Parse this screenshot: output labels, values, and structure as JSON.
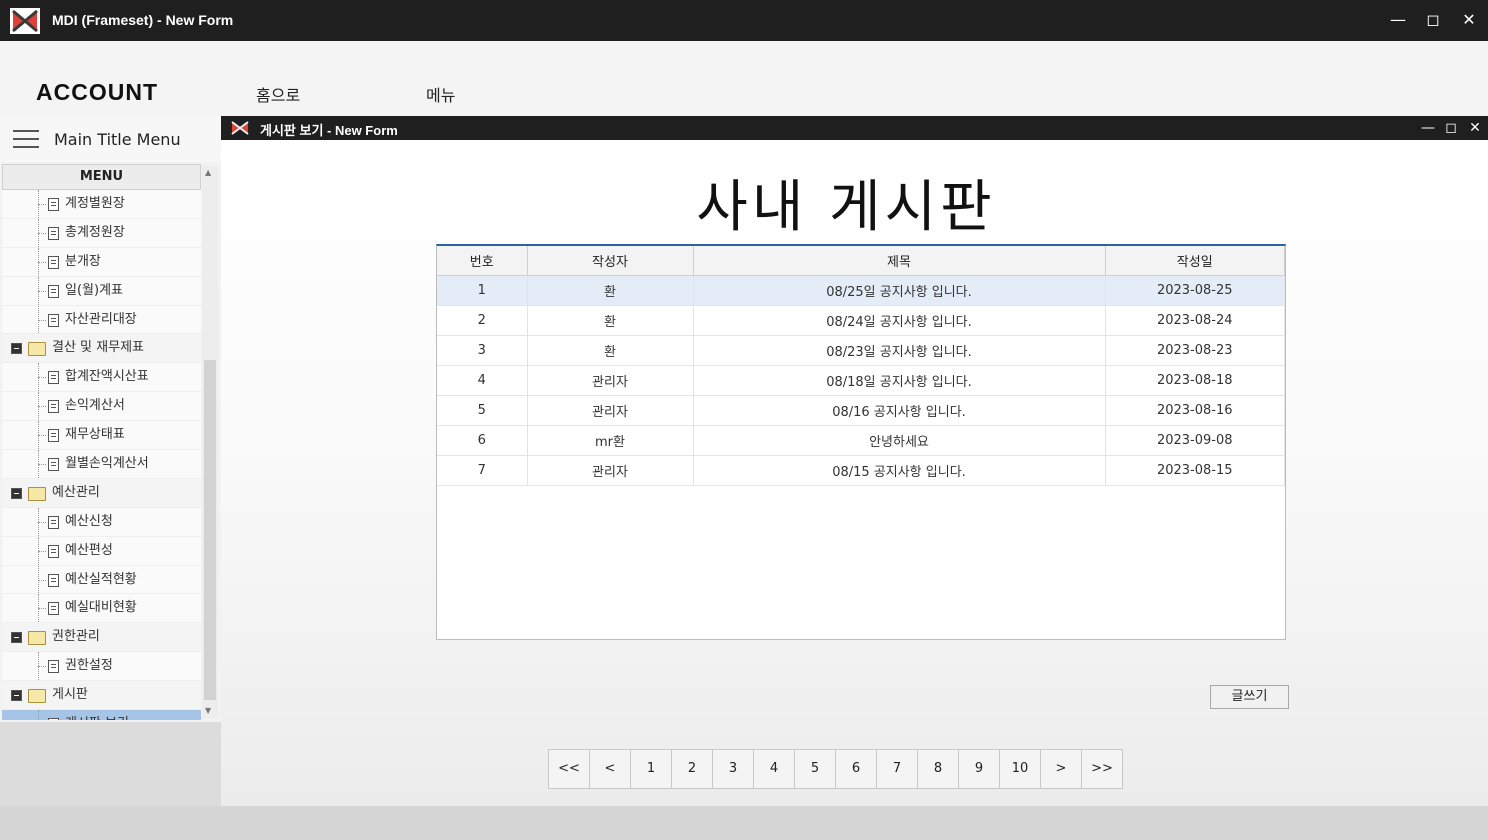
{
  "window": {
    "title": "MDI (Frameset) - New Form"
  },
  "topnav": {
    "brand": "ACCOUNT",
    "links": [
      "홈으로",
      "메뉴"
    ]
  },
  "sidebar": {
    "title": "Main Title Menu",
    "menu_header": "MENU",
    "items": [
      {
        "label": "계정별원장",
        "type": "leaf"
      },
      {
        "label": "총계정원장",
        "type": "leaf"
      },
      {
        "label": "분개장",
        "type": "leaf"
      },
      {
        "label": "일(월)계표",
        "type": "leaf"
      },
      {
        "label": "자산관리대장",
        "type": "leaf"
      },
      {
        "label": "결산 및 재무제표",
        "type": "folder"
      },
      {
        "label": "합계잔액시산표",
        "type": "leaf"
      },
      {
        "label": "손익계산서",
        "type": "leaf"
      },
      {
        "label": "재무상태표",
        "type": "leaf"
      },
      {
        "label": "월별손익계산서",
        "type": "leaf"
      },
      {
        "label": "예산관리",
        "type": "folder"
      },
      {
        "label": "예산신청",
        "type": "leaf"
      },
      {
        "label": "예산편성",
        "type": "leaf"
      },
      {
        "label": "예산실적현황",
        "type": "leaf"
      },
      {
        "label": "예실대비현황",
        "type": "leaf"
      },
      {
        "label": "권한관리",
        "type": "folder"
      },
      {
        "label": "권한설정",
        "type": "leaf"
      },
      {
        "label": "게시판",
        "type": "folder"
      },
      {
        "label": "게시판 보기",
        "type": "leaf",
        "selected": true
      }
    ]
  },
  "child_window": {
    "title": "게시판 보기 - New Form",
    "board_title": "사내 게시판",
    "columns": [
      "번호",
      "작성자",
      "제목",
      "작성일"
    ],
    "rows": [
      [
        "1",
        "환",
        "08/25일 공지사항 입니다.",
        "2023-08-25"
      ],
      [
        "2",
        "환",
        "08/24일 공지사항 입니다.",
        "2023-08-24"
      ],
      [
        "3",
        "환",
        "08/23일 공지사항 입니다.",
        "2023-08-23"
      ],
      [
        "4",
        "관리자",
        "08/18일 공지사항 입니다.",
        "2023-08-18"
      ],
      [
        "5",
        "관리자",
        "08/16 공지사항 입니다.",
        "2023-08-16"
      ],
      [
        "6",
        "mr환",
        "안녕하세요",
        "2023-09-08"
      ],
      [
        "7",
        "관리자",
        "08/15 공지사항 입니다.",
        "2023-08-15"
      ]
    ],
    "selected_row": 0,
    "write_button": "글쓰기",
    "pager": [
      "<<",
      "<",
      "1",
      "2",
      "3",
      "4",
      "5",
      "6",
      "7",
      "8",
      "9",
      "10",
      ">",
      ">>"
    ]
  },
  "colors": {
    "titlebar": "#1f1f1f",
    "accent": "#2a62a8",
    "selected": "#a6c5e6",
    "logo_red": "#e0403a"
  }
}
